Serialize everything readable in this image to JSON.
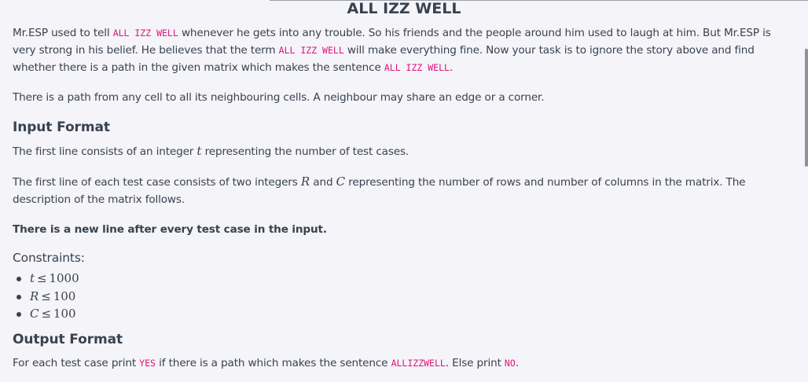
{
  "title": "ALL IZZ WELL",
  "intro": {
    "t1": "Mr.ESP used to tell ",
    "c1": "ALL IZZ WELL",
    "t2": " whenever he gets into any trouble. So his friends and the people around him used to laugh at him. But Mr.ESP is very strong in his belief. He believes that the term ",
    "c2": "ALL IZZ WELL",
    "t3": " will make everything fine. Now your task is to ignore the story above and find whether there is a path in the given matrix which makes the sentence ",
    "c3": "ALL IZZ WELL",
    "t4": "."
  },
  "neighbour_text": "There is a path from any cell to all its neighbouring cells. A neighbour may share an edge or a corner.",
  "input_format": {
    "heading": "Input Format",
    "line1": {
      "a": "The first line consists of an integer ",
      "var": "t",
      "b": " representing the number of test cases."
    },
    "line2": {
      "a": "The first line of each test case consists of two integers ",
      "var1": "R",
      "mid": " and ",
      "var2": "C",
      "b": " representing the number of rows and number of columns in the matrix. The description of the matrix follows."
    },
    "note": "There is a new line after every test case in the input."
  },
  "constraints": {
    "label": "Constraints:",
    "items": [
      {
        "var": "t",
        "op": "≤",
        "value": "1000"
      },
      {
        "var": "R",
        "op": "≤",
        "value": "100"
      },
      {
        "var": "C",
        "op": "≤",
        "value": "100"
      }
    ]
  },
  "output_format": {
    "heading": "Output Format",
    "t1": "For each test case print ",
    "c1": "YES",
    "t2": " if there is a path which makes the sentence ",
    "c2": "ALLIZZWELL",
    "t3": ". Else print ",
    "c3": "NO",
    "t4": "."
  }
}
